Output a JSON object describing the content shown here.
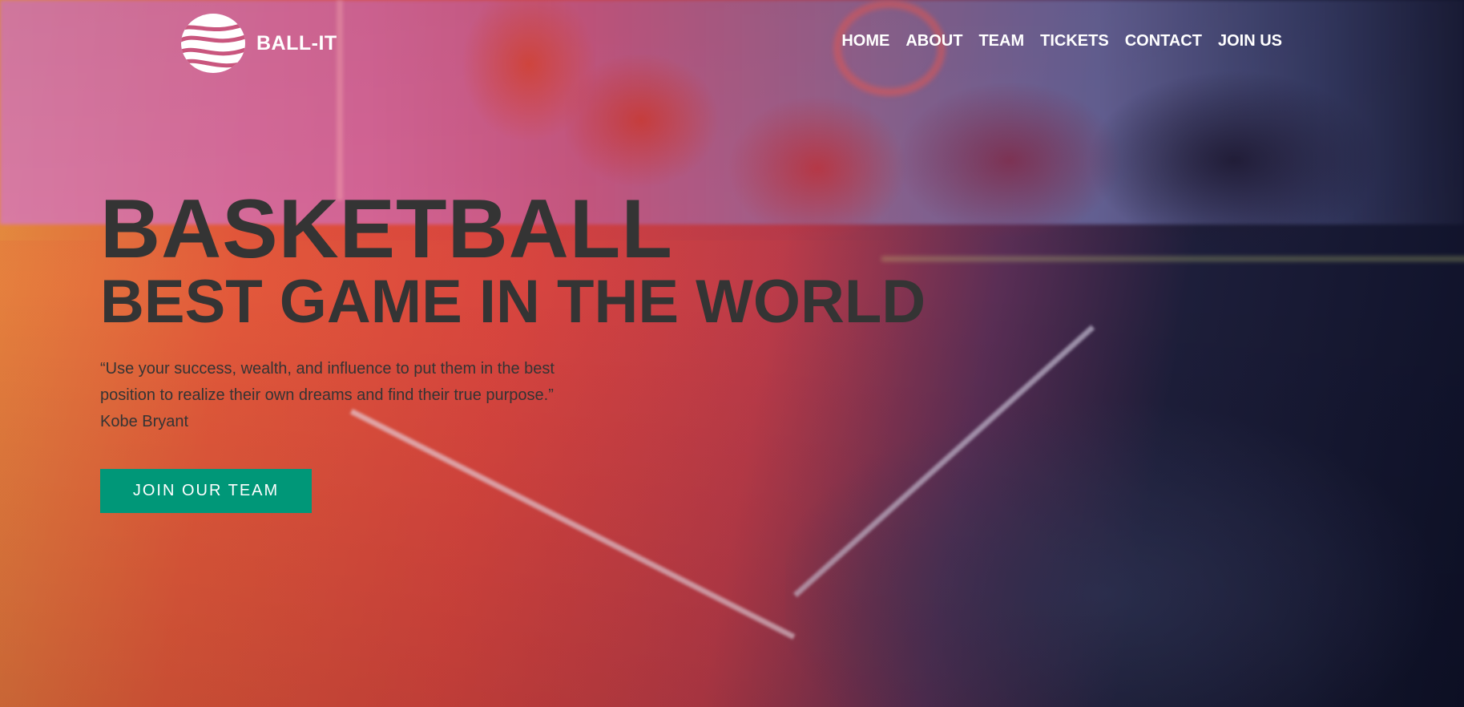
{
  "brand": {
    "name": "BALL-IT",
    "logo_icon": "wavy-ball-logo"
  },
  "nav": {
    "items": [
      {
        "label": "HOME"
      },
      {
        "label": "ABOUT"
      },
      {
        "label": "TEAM"
      },
      {
        "label": "TICKETS"
      },
      {
        "label": "CONTACT"
      },
      {
        "label": "JOIN US"
      }
    ]
  },
  "hero": {
    "title": "BASKETBALL",
    "subtitle": "BEST GAME IN THE WORLD",
    "quote_line1": "“Use your success, wealth, and influence to put them in the best",
    "quote_line2": "position to realize their own dreams and find their true purpose.”",
    "quote_author": "Kobe Bryant",
    "cta_label": "JOIN OUR TEAM"
  },
  "colors": {
    "cta_background": "#009778",
    "heading_text": "#343434",
    "nav_text": "#ffffff"
  }
}
